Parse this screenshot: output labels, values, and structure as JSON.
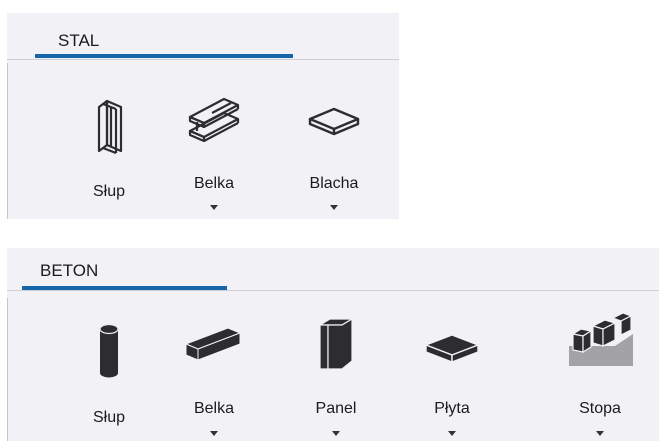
{
  "stal": {
    "tab": "STAL",
    "tools": {
      "slup": {
        "label": "Słup",
        "icon": "steel-column-icon"
      },
      "belka": {
        "label": "Belka",
        "icon": "steel-beam-icon"
      },
      "blacha": {
        "label": "Blacha",
        "icon": "steel-plate-icon"
      }
    }
  },
  "beton": {
    "tab": "BETON",
    "tools": {
      "slup": {
        "label": "Słup",
        "icon": "concrete-column-icon"
      },
      "belka": {
        "label": "Belka",
        "icon": "concrete-beam-icon"
      },
      "panel": {
        "label": "Panel",
        "icon": "concrete-panel-icon"
      },
      "plyta": {
        "label": "Płyta",
        "icon": "concrete-slab-icon"
      },
      "stopa": {
        "label": "Stopa",
        "icon": "footing-icon"
      }
    }
  },
  "colors": {
    "accent": "#1565ad",
    "panel_bg": "#f2f1f5",
    "icon": "#2d2d30"
  }
}
